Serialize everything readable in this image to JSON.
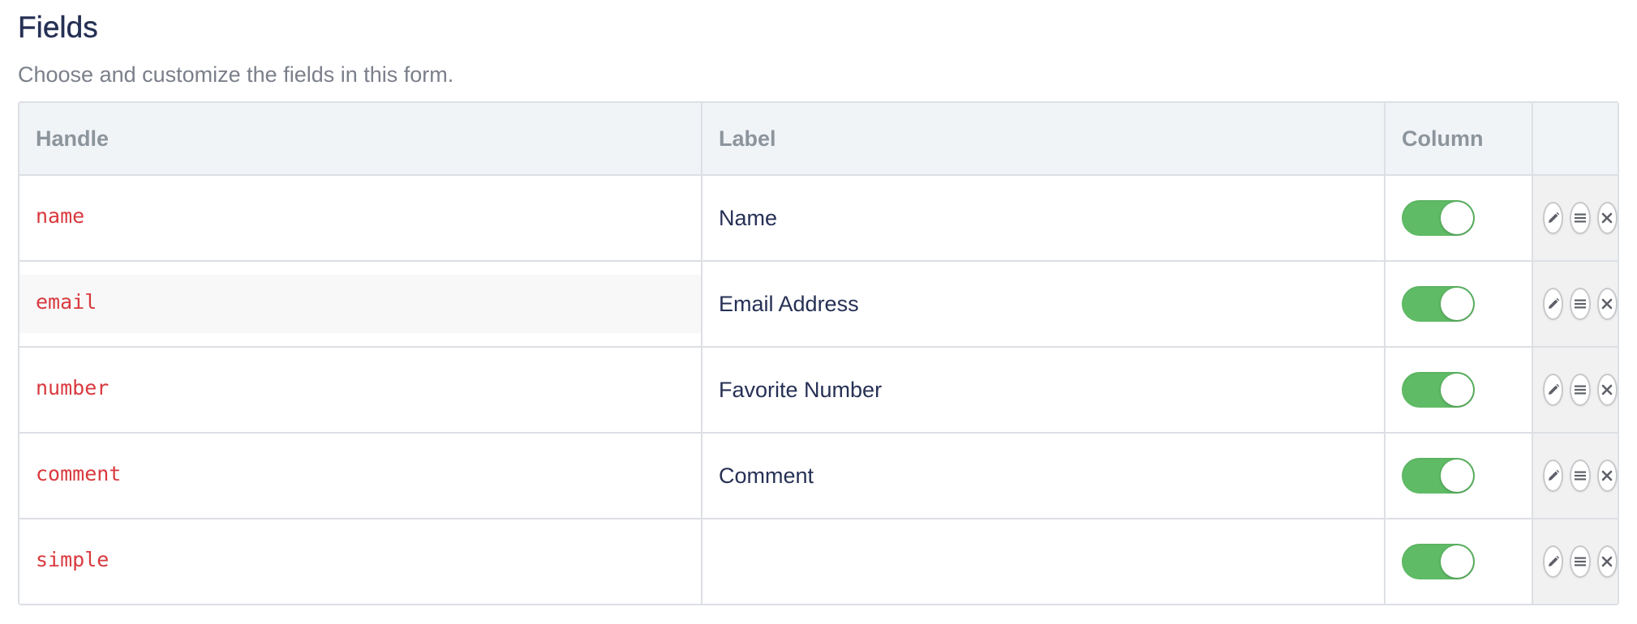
{
  "section": {
    "title": "Fields",
    "description": "Choose and customize the fields in this form."
  },
  "table": {
    "headers": {
      "handle": "Handle",
      "label": "Label",
      "column": "Column",
      "actions": ""
    },
    "rows": [
      {
        "handle": "name",
        "label": "Name",
        "column_enabled": true
      },
      {
        "handle": "email",
        "label": "Email Address",
        "column_enabled": true
      },
      {
        "handle": "number",
        "label": "Favorite Number",
        "column_enabled": true
      },
      {
        "handle": "comment",
        "label": "Comment",
        "column_enabled": true
      },
      {
        "handle": "simple",
        "label": "",
        "column_enabled": true
      }
    ],
    "row_actions": [
      "pencil-icon",
      "drag-handle-icon",
      "close-icon"
    ]
  },
  "colors": {
    "heading": "#263055",
    "description": "#7b7f8a",
    "handle_code": "#d9393e",
    "toggle_on": "#5fbb65",
    "header_bg": "#f1f4f7",
    "actions_bg": "#f1f1f1",
    "border": "#dcdfe4"
  }
}
